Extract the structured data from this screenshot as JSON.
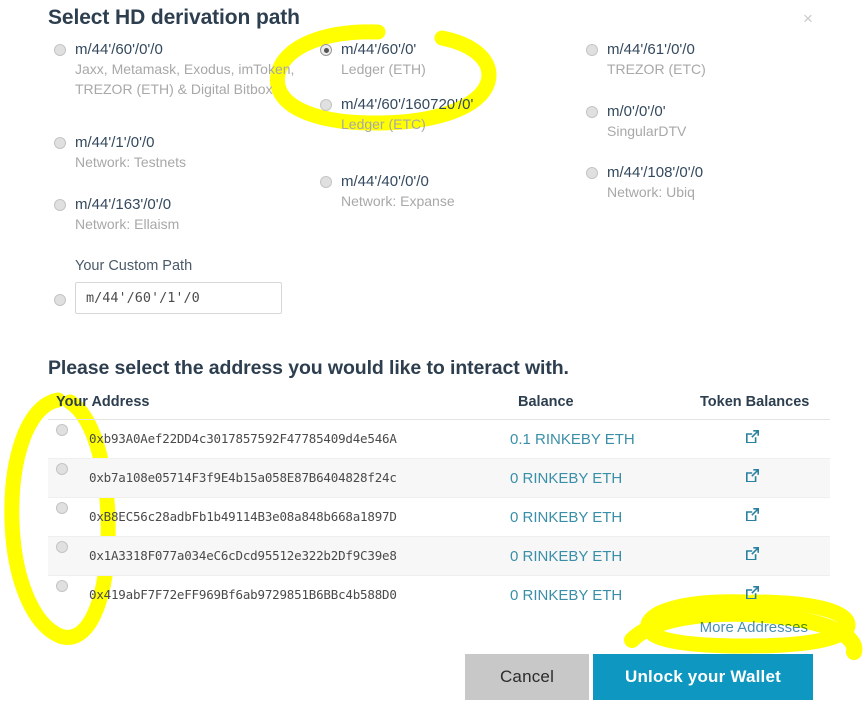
{
  "modal": {
    "title": "Select HD derivation path",
    "subtitle": "Please select the address you would like to interact with.",
    "close_label": "×"
  },
  "accent_colors": {
    "unlock_button": "#0e97c0",
    "cancel_button": "#c8c8c8",
    "link": "#3a8fa8",
    "highlighter": "#ffff00"
  },
  "paths": {
    "columns": [
      {
        "options": [
          {
            "path": "m/44'/60'/0'/0",
            "desc": "Jaxx, Metamask, Exodus, imToken, TREZOR (ETH) & Digital Bitbox",
            "selected": false
          },
          {
            "path": "m/44'/1'/0'/0",
            "desc": "Network: Testnets",
            "selected": false
          },
          {
            "path": "m/44'/163'/0'/0",
            "desc": "Network: Ellaism",
            "selected": false
          }
        ],
        "custom": {
          "label": "Your Custom Path",
          "value": "m/44'/60'/1'/0",
          "selected": false
        }
      },
      {
        "options": [
          {
            "path": "m/44'/60'/0'",
            "desc": "Ledger (ETH)",
            "selected": true
          },
          {
            "path": "m/44'/60'/160720'/0'",
            "desc": "Ledger (ETC)",
            "selected": false
          },
          {
            "path": "m/44'/40'/0'/0",
            "desc": "Network: Expanse",
            "selected": false
          }
        ]
      },
      {
        "options": [
          {
            "path": "m/44'/61'/0'/0",
            "desc": "TREZOR (ETC)",
            "selected": false
          },
          {
            "path": "m/0'/0'/0'",
            "desc": "SingularDTV",
            "selected": false
          },
          {
            "path": "m/44'/108'/0'/0",
            "desc": "Network: Ubiq",
            "selected": false
          }
        ]
      }
    ]
  },
  "address_table": {
    "headers": {
      "address": "Your Address",
      "balance": "Balance",
      "token_balances": "Token Balances"
    },
    "rows": [
      {
        "address": "0xb93A0Aef22DD4c3017857592F47785409d4e546A",
        "balance": "0.1 RINKEBY ETH",
        "token_icon": "external-link-icon",
        "selected": false
      },
      {
        "address": "0xb7a108e05714F3f9E4b15a058E87B6404828f24c",
        "balance": "0 RINKEBY ETH",
        "token_icon": "external-link-icon",
        "selected": false
      },
      {
        "address": "0xB8EC56c28adbFb1b49114B3e08a848b668a1897D",
        "balance": "0 RINKEBY ETH",
        "token_icon": "external-link-icon",
        "selected": false
      },
      {
        "address": "0x1A3318F077a034eC6cDcd95512e322b2Df9C39e8",
        "balance": "0 RINKEBY ETH",
        "token_icon": "external-link-icon",
        "selected": false
      },
      {
        "address": "0x419abF7F72eFF969Bf6ab9729851B6BBc4b588D0",
        "balance": "0 RINKEBY ETH",
        "token_icon": "external-link-icon",
        "selected": false
      }
    ],
    "more_addresses": "More Addresses"
  },
  "footer": {
    "cancel_label": "Cancel",
    "unlock_label": "Unlock your Wallet"
  }
}
